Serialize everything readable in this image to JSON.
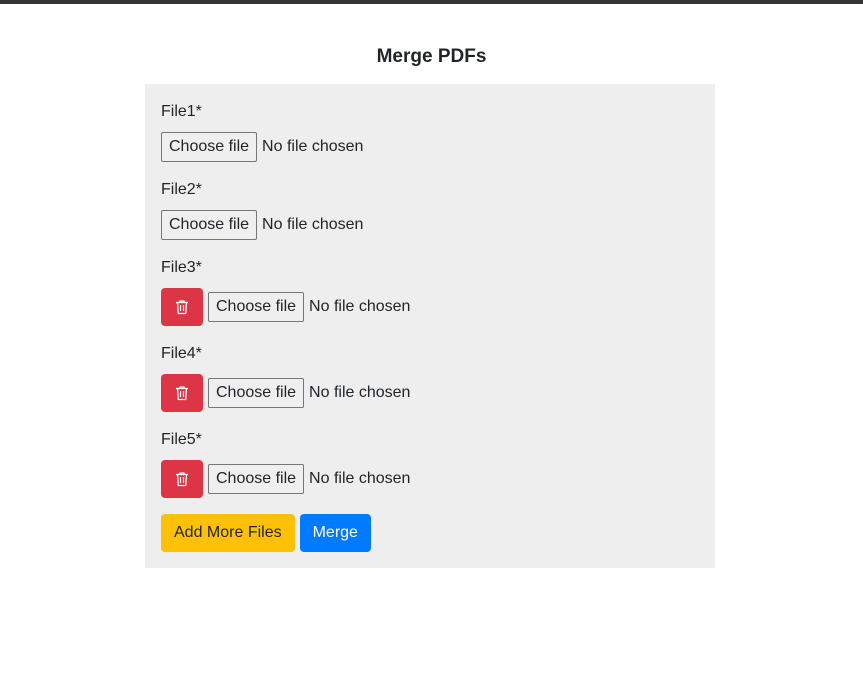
{
  "page": {
    "title": "Merge PDFs"
  },
  "files": [
    {
      "label": "File1*",
      "choose_label": "Choose file",
      "status": "No file chosen",
      "removable": false
    },
    {
      "label": "File2*",
      "choose_label": "Choose file",
      "status": "No file chosen",
      "removable": false
    },
    {
      "label": "File3*",
      "choose_label": "Choose file",
      "status": "No file chosen",
      "removable": true
    },
    {
      "label": "File4*",
      "choose_label": "Choose file",
      "status": "No file chosen",
      "removable": true
    },
    {
      "label": "File5*",
      "choose_label": "Choose file",
      "status": "No file chosen",
      "removable": true
    }
  ],
  "actions": {
    "add_more_label": "Add More Files",
    "merge_label": "Merge"
  },
  "icons": {
    "delete": "trash-icon"
  },
  "colors": {
    "panel_background": "#eeeeee",
    "danger": "#dc3545",
    "warning": "#ffc107",
    "primary": "#007bff"
  }
}
